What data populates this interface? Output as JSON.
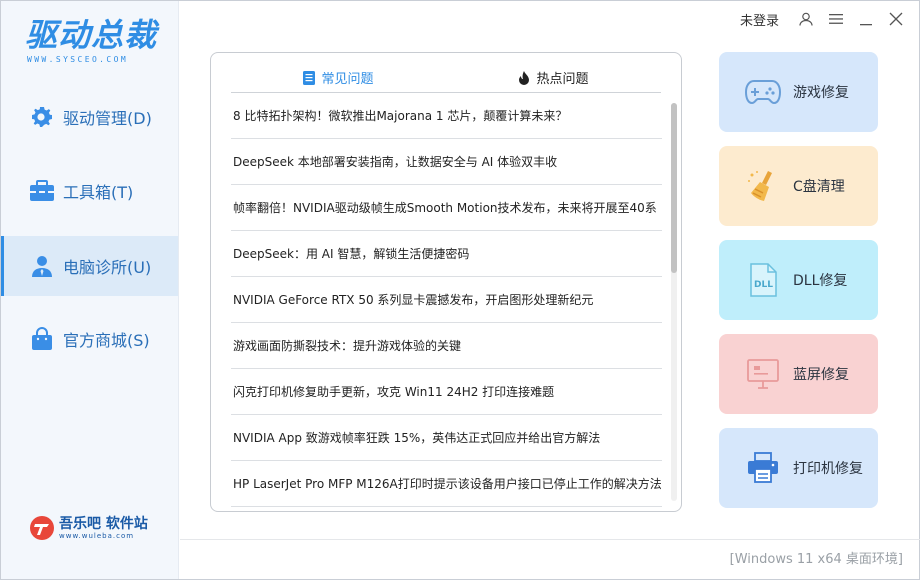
{
  "app": {
    "logo_main": "驱动总裁",
    "logo_sub": "WWW.SYSCEO.COM"
  },
  "titlebar": {
    "login": "未登录",
    "icons": [
      "user-icon",
      "menu-icon",
      "minimize-icon",
      "close-icon"
    ]
  },
  "sidebar": {
    "items": [
      {
        "label": "驱动管理(D)",
        "icon": "gear-icon",
        "active": false
      },
      {
        "label": "工具箱(T)",
        "icon": "toolbox-icon",
        "active": false
      },
      {
        "label": "电脑诊所(U)",
        "icon": "person-icon",
        "active": true
      },
      {
        "label": "官方商城(S)",
        "icon": "shopping-bag-icon",
        "active": false
      }
    ],
    "brand": "吾乐吧 软件站",
    "brand_sub": "www.wuleba.com"
  },
  "tabs": [
    {
      "label": "常见问题",
      "icon": "document-icon",
      "active": true
    },
    {
      "label": "热点问题",
      "icon": "flame-icon",
      "active": false
    }
  ],
  "articles": [
    "8 比特拓扑架构！微软推出Majorana 1 芯片，颠覆计算未来？",
    "DeepSeek 本地部署安装指南，让数据安全与 AI 体验双丰收",
    "帧率翻倍！NVIDIA驱动级帧生成Smooth Motion技术发布，未来将开展至40系",
    "DeepSeek：用 AI 智慧，解锁生活便捷密码",
    "NVIDIA GeForce RTX 50 系列显卡震撼发布，开启图形处理新纪元",
    "游戏画面防撕裂技术：提升游戏体验的关键",
    "闪克打印机修复助手更新，攻克 Win11 24H2 打印连接难题",
    "NVIDIA App 致游戏帧率狂跌 15%，英伟达正式回应并给出官方解法",
    "HP LaserJet Pro MFP M126A打印时提示该设备用户接口已停止工作的解决方法"
  ],
  "cards": [
    {
      "label": "游戏修复",
      "icon": "gamepad-icon",
      "color": "#d6e7fb"
    },
    {
      "label": "C盘清理",
      "icon": "broom-icon",
      "color": "#fdebcf"
    },
    {
      "label": "DLL修复",
      "icon": "dll-file-icon",
      "color": "#bfeefb"
    },
    {
      "label": "蓝屏修复",
      "icon": "monitor-icon",
      "color": "#f9d2d2"
    },
    {
      "label": "打印机修复",
      "icon": "printer-icon",
      "color": "#d6e7fb"
    }
  ],
  "footer": {
    "environment": "[Windows 11 x64 桌面环境]"
  },
  "colors": {
    "accent": "#2f8de4",
    "sidebar_bg": "#f3f7fc",
    "active_nav": "#dceaf8"
  }
}
